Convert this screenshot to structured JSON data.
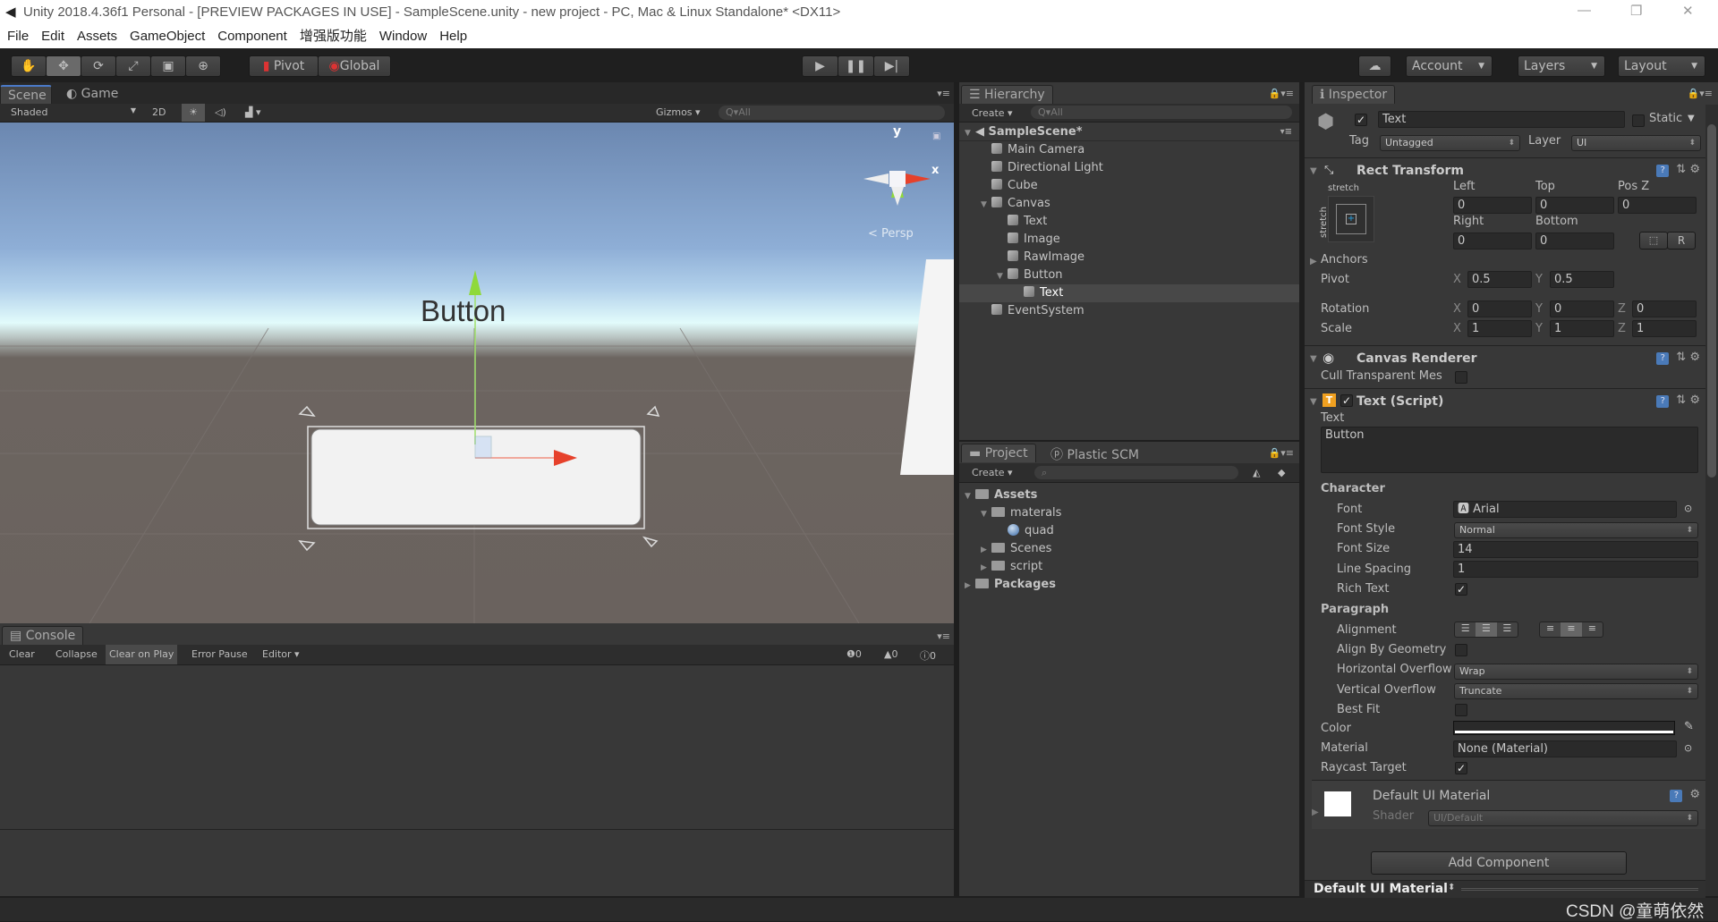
{
  "window": {
    "title": "Unity 2018.4.36f1 Personal - [PREVIEW PACKAGES IN USE] - SampleScene.unity - new project - PC, Mac & Linux Standalone* <DX11>",
    "controls": [
      "—",
      "❐",
      "✕"
    ]
  },
  "menu": [
    "File",
    "Edit",
    "Assets",
    "GameObject",
    "Component",
    "增强版功能",
    "Window",
    "Help"
  ],
  "toolbar": {
    "tools": [
      "hand-icon",
      "move-icon",
      "rotate-icon",
      "scale-icon",
      "rect-icon",
      "transform-icon"
    ],
    "pivot": "Pivot",
    "global": "Global",
    "account": "Account",
    "layers": "Layers",
    "layout": "Layout"
  },
  "scene": {
    "tabs": [
      "Scene",
      "Game"
    ],
    "shading": "Shaded",
    "mode2d": "2D",
    "gizmos": "Gizmos",
    "search_placeholder": "All",
    "persp": "Persp",
    "axis_y": "y",
    "axis_x": "x",
    "button_text": "Button"
  },
  "console": {
    "tab": "Console",
    "buttons": [
      "Clear",
      "Collapse",
      "Clear on Play",
      "Error Pause",
      "Editor"
    ],
    "counts": {
      "info": "0",
      "warn": "0",
      "error": "0"
    }
  },
  "hierarchy": {
    "tab": "Hierarchy",
    "create": "Create",
    "search_placeholder": "All",
    "scene": "SampleScene*",
    "items": [
      {
        "label": "Main Camera",
        "depth": 1
      },
      {
        "label": "Directional Light",
        "depth": 1
      },
      {
        "label": "Cube",
        "depth": 1
      },
      {
        "label": "Canvas",
        "depth": 1,
        "expanded": true
      },
      {
        "label": "Text",
        "depth": 2
      },
      {
        "label": "Image",
        "depth": 2
      },
      {
        "label": "RawImage",
        "depth": 2
      },
      {
        "label": "Button",
        "depth": 2,
        "expanded": true
      },
      {
        "label": "Text",
        "depth": 3,
        "selected": true
      },
      {
        "label": "EventSystem",
        "depth": 1
      }
    ]
  },
  "project": {
    "tabs": [
      "Project",
      "Plastic SCM"
    ],
    "create": "Create",
    "items": [
      {
        "label": "Assets",
        "depth": 0,
        "expanded": true,
        "bold": true
      },
      {
        "label": "materals",
        "depth": 1,
        "expanded": true
      },
      {
        "label": "quad",
        "depth": 2,
        "material": true
      },
      {
        "label": "Scenes",
        "depth": 1,
        "collapsed": true
      },
      {
        "label": "script",
        "depth": 1,
        "collapsed": true
      },
      {
        "label": "Packages",
        "depth": 0,
        "collapsed": true,
        "bold": true
      }
    ]
  },
  "inspector": {
    "tab": "Inspector",
    "name": "Text",
    "static": "Static",
    "tag_label": "Tag",
    "tag": "Untagged",
    "layer_label": "Layer",
    "layer": "UI",
    "rect": {
      "title": "Rect Transform",
      "stretch_h": "stretch",
      "stretch_v": "stretch",
      "left_l": "Left",
      "top_l": "Top",
      "posz_l": "Pos Z",
      "left": "0",
      "top": "0",
      "posz": "0",
      "right_l": "Right",
      "bottom_l": "Bottom",
      "right": "0",
      "bottom": "0",
      "r": "R",
      "anchors": "Anchors",
      "pivot": "Pivot",
      "pivot_x": "0.5",
      "pivot_y": "0.5",
      "rotation": "Rotation",
      "rot": [
        "0",
        "0",
        "0"
      ],
      "scale": "Scale",
      "scl": [
        "1",
        "1",
        "1"
      ],
      "x": "X",
      "y": "Y",
      "z": "Z"
    },
    "canvas": {
      "title": "Canvas Renderer",
      "cull": "Cull Transparent Mes"
    },
    "text": {
      "title": "Text (Script)",
      "text_label": "Text",
      "text_value": "Button",
      "character": "Character",
      "font_l": "Font",
      "font": "Arial",
      "style_l": "Font Style",
      "style": "Normal",
      "size_l": "Font Size",
      "size": "14",
      "spacing_l": "Line Spacing",
      "spacing": "1",
      "rich_l": "Rich Text",
      "paragraph": "Paragraph",
      "align_l": "Alignment",
      "geom_l": "Align By Geometry",
      "hover_l": "Horizontal Overflow",
      "hover": "Wrap",
      "vover_l": "Vertical Overflow",
      "vover": "Truncate",
      "best_l": "Best Fit",
      "color_l": "Color",
      "color": "#ffffff",
      "material_l": "Material",
      "material": "None (Material)",
      "raycast_l": "Raycast Target"
    },
    "mat": {
      "title": "Default UI Material",
      "shader_l": "Shader",
      "shader": "UI/Default"
    },
    "add": "Add Component",
    "footer": "Default UI Material"
  },
  "watermark": "CSDN @童萌依然"
}
